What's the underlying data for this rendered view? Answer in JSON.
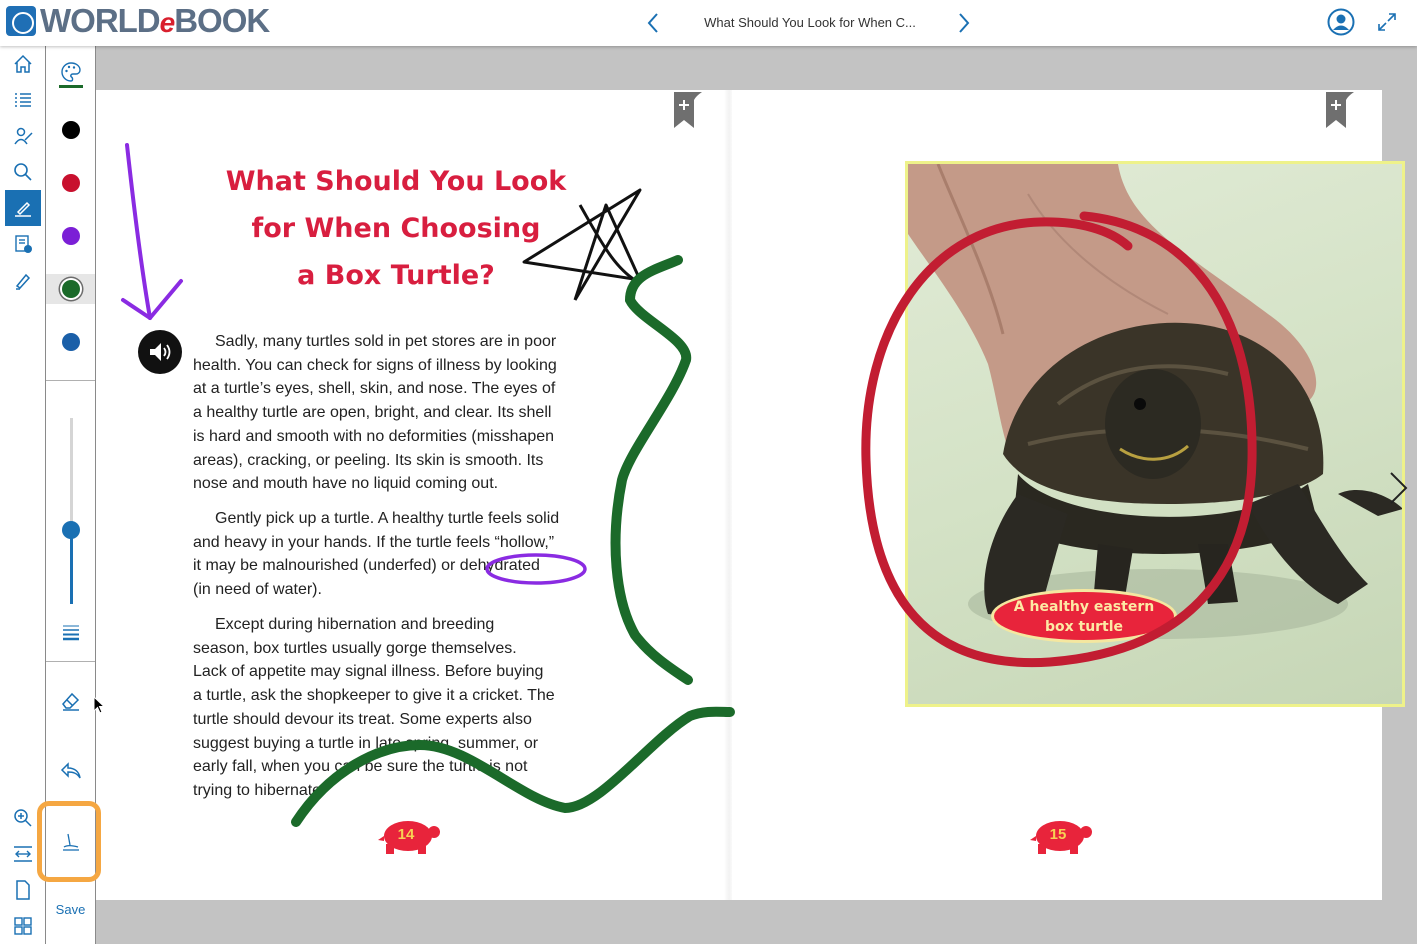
{
  "header": {
    "logo_text": "WORLD",
    "logo_e": "e",
    "logo_book": "BOOK",
    "book_title": "What Should You Look for When C..."
  },
  "left_nav": {
    "items": [
      "home-icon",
      "table-of-contents-icon",
      "reader-icon",
      "search-icon",
      "annotate-icon",
      "notes-icon",
      "highlighter-icon",
      "zoom-in-icon",
      "fit-width-icon",
      "single-page-icon",
      "thumbnails-icon"
    ],
    "active": "annotate-icon"
  },
  "draw_toolbar": {
    "colors": [
      "#000000",
      "#c8102e",
      "#7b1fd6",
      "#1b6a2a",
      "#1a5fa8"
    ],
    "selected_color": "#1b6a2a",
    "stroke_width_level": 0.4,
    "save_label": "Save"
  },
  "page_left": {
    "title_lines": [
      "What Should You Look",
      "for When Choosing",
      "a Box Turtle?"
    ],
    "paragraphs": [
      [
        "Sadly, many turtles sold in pet stores are in poor",
        "health. You can check for signs of illness by looking",
        "at a turtle’s eyes, shell, skin, and nose. The eyes of",
        "a healthy turtle are open, bright, and clear. Its shell",
        "is hard and smooth with no deformities (misshapen",
        "areas), cracking, or peeling. Its skin is smooth. Its",
        "nose and mouth have no liquid coming out."
      ],
      [
        "Gently pick up a turtle. A healthy turtle feels solid",
        "and heavy in your hands. If the turtle feels “hollow,”",
        "it may be malnourished (underfed) or dehydrated",
        "(in need of water)."
      ],
      [
        "Except during hibernation and breeding",
        "season, box turtles usually gorge themselves.",
        "Lack of appetite may signal illness. Before buying",
        "a turtle, ask the shopkeeper to give it a cricket. The",
        "turtle should devour its treat. Some experts also",
        "suggest buying a turtle in late spring, summer, or",
        "early fall, when you can be sure the turtle is not",
        "trying to hibernate."
      ]
    ],
    "page_number": "14"
  },
  "page_right": {
    "caption_lines": [
      "A healthy eastern",
      "box turtle"
    ],
    "page_number": "15"
  },
  "colors": {
    "accent": "#1a70b3",
    "title_red": "#d81e3f",
    "save_highlight": "#f5a742"
  }
}
